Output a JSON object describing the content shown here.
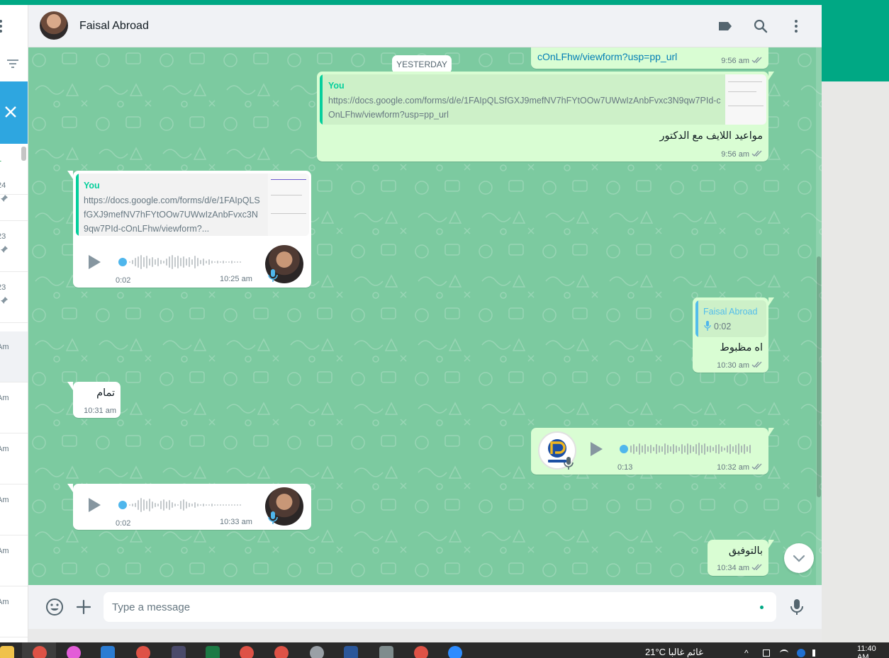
{
  "header": {
    "contact_name": "Faisal Abroad"
  },
  "sidebar": {
    "rows": [
      {
        "time": "1",
        "pinned": false,
        "active": false,
        "unread": true
      },
      {
        "time": "24",
        "pinned": true,
        "active": false
      },
      {
        "time": "23",
        "pinned": true,
        "active": false
      },
      {
        "time": "23",
        "pinned": true,
        "active": false
      },
      {
        "time": "Am",
        "pinned": false,
        "active": true
      },
      {
        "time": "Am",
        "pinned": false,
        "active": false
      },
      {
        "time": "Am",
        "pinned": false,
        "active": false
      },
      {
        "time": "Am",
        "pinned": false,
        "active": false
      },
      {
        "time": "Am",
        "pinned": false,
        "active": false
      },
      {
        "time": "Am",
        "pinned": false,
        "active": false
      }
    ]
  },
  "chat": {
    "date_divider": "YESTERDAY",
    "messages": [
      {
        "id": "m0",
        "link_tail": "cOnLFhw/viewform?usp=pp_url",
        "time": "9:56 am"
      },
      {
        "id": "m1",
        "quote_name": "You",
        "quote_text": "https://docs.google.com/forms/d/e/1FAIpQLSfGXJ9mefNV7hFYtOOw7UWwIzAnbFvxc3N9qw7PId-cOnLFhw/viewform?usp=pp_url",
        "text": "مواعيد اللايف مع الدكتور",
        "time": "9:56 am"
      },
      {
        "id": "m2",
        "quote_name": "You",
        "quote_text": "https://docs.google.com/forms/d/e/1FAIpQLSfGXJ9mefNV7hFYtOOw7UWwIzAnbFvxc3N9qw7PId-cOnLFhw/viewform?...",
        "duration": "0:02",
        "time": "10:25 am"
      },
      {
        "id": "m3",
        "quote_name": "Faisal Abroad",
        "quote_duration": "0:02",
        "text": "اه مظبوط",
        "time": "10:30 am"
      },
      {
        "id": "m4",
        "text": "تمام",
        "time": "10:31 am"
      },
      {
        "id": "m5",
        "duration": "0:13",
        "time": "10:32 am"
      },
      {
        "id": "m6",
        "duration": "0:02",
        "time": "10:33 am"
      },
      {
        "id": "m7",
        "text": "بالتوفيق",
        "time": "10:34 am"
      }
    ]
  },
  "composer": {
    "placeholder": "Type a message"
  },
  "taskbar": {
    "weather": "21°C  غائم غالبا",
    "clock": "11:40 AM"
  },
  "colors": {
    "brand_green": "#00a884",
    "chat_background": "#7ccaa0",
    "outgoing_bubble": "#d9fdd3",
    "incoming_bubble": "#ffffff",
    "quote_accent": "#06cf9c",
    "read_ticks": "#53bdeb",
    "link": "#027eb5"
  },
  "icons": {
    "header": [
      "label-icon",
      "search-icon",
      "menu-dots-icon"
    ],
    "composer": [
      "emoji-icon",
      "plus-icon",
      "mic-icon"
    ]
  }
}
